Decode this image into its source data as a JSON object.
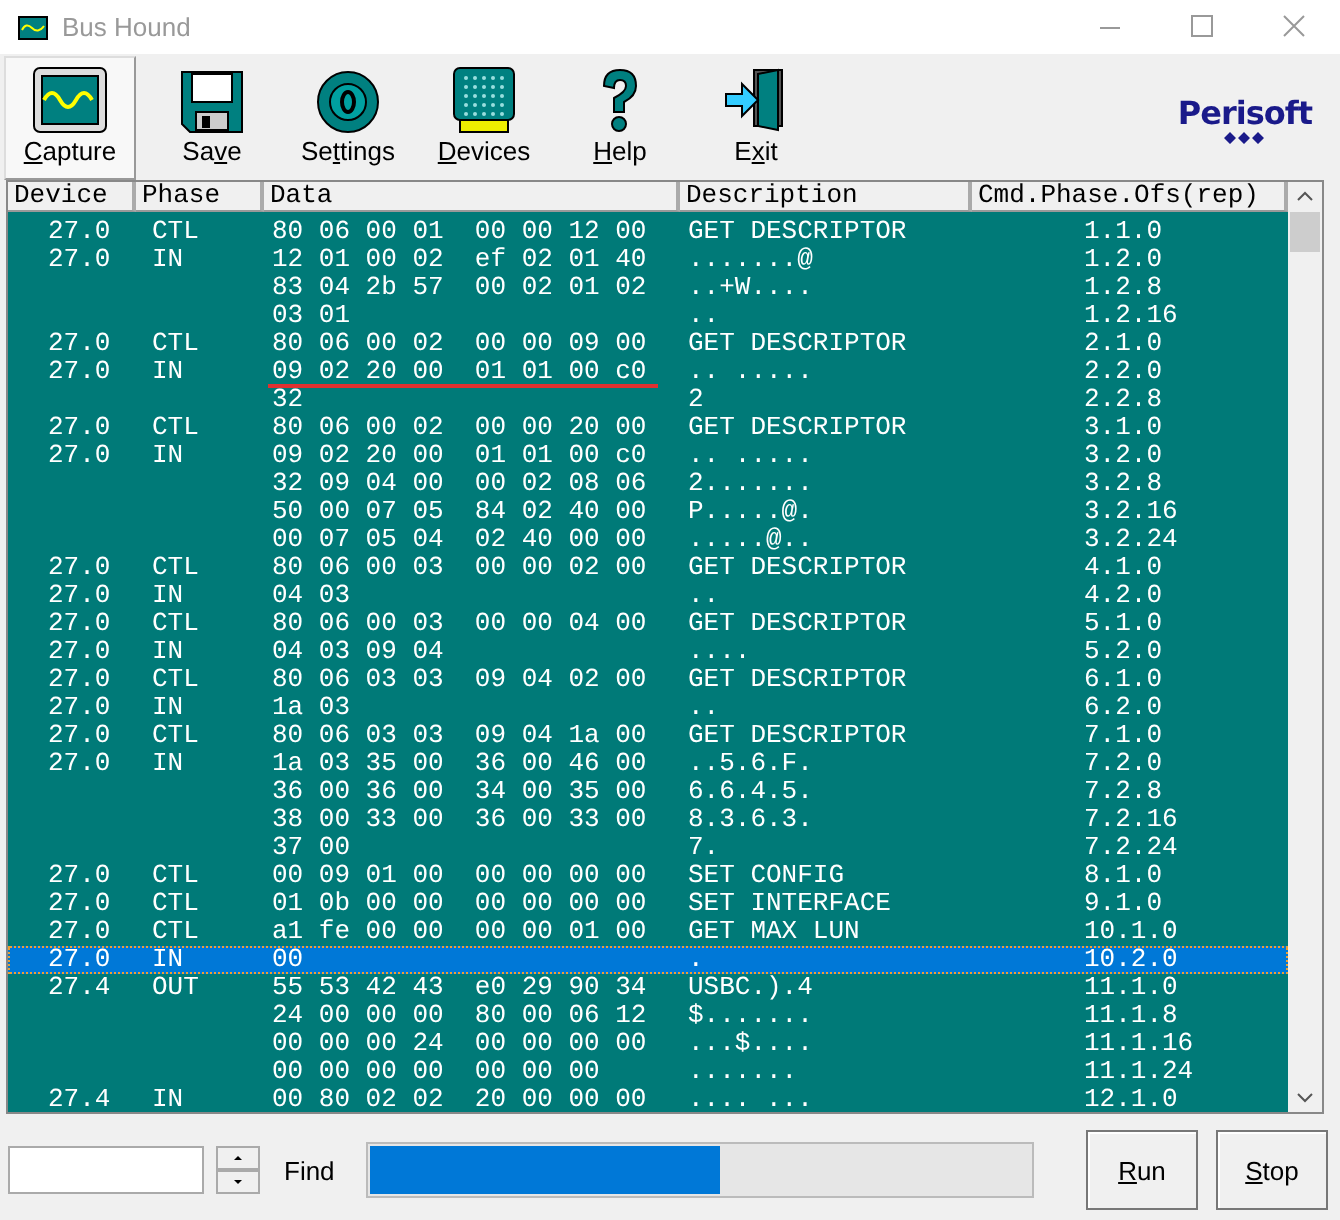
{
  "window": {
    "title": "Bus Hound"
  },
  "toolbar": [
    {
      "key": "C",
      "post": "apture",
      "selected": true
    },
    {
      "pre": "Sa",
      "key": "v",
      "post": "e",
      "selected": false
    },
    {
      "pre": "Se",
      "key": "t",
      "post": "tings",
      "selected": false
    },
    {
      "key": "D",
      "post": "evices",
      "selected": false
    },
    {
      "key": "H",
      "post": "elp",
      "selected": false
    },
    {
      "pre": "E",
      "key": "x",
      "post": "it",
      "selected": false
    }
  ],
  "logo": {
    "text": "Perisoft"
  },
  "table": {
    "columns": [
      "Device",
      "Phase",
      "Data",
      "Description",
      "Cmd.Phase.Ofs(rep)"
    ],
    "rows": [
      {
        "device": "27.0",
        "phase": "CTL",
        "data": "80 06 00 01  00 00 12 00",
        "description": "GET DESCRIPTOR",
        "cmd": "1.1.0",
        "selected": false,
        "underlined": false
      },
      {
        "device": "27.0",
        "phase": "IN",
        "data": "12 01 00 02  ef 02 01 40",
        "description": ".......@",
        "cmd": "1.2.0",
        "selected": false,
        "underlined": false
      },
      {
        "device": "",
        "phase": "",
        "data": "83 04 2b 57  00 02 01 02",
        "description": "..+W....",
        "cmd": "1.2.8",
        "selected": false,
        "underlined": false
      },
      {
        "device": "",
        "phase": "",
        "data": "03 01",
        "description": "..",
        "cmd": "1.2.16",
        "selected": false,
        "underlined": false
      },
      {
        "device": "27.0",
        "phase": "CTL",
        "data": "80 06 00 02  00 00 09 00",
        "description": "GET DESCRIPTOR",
        "cmd": "2.1.0",
        "selected": false,
        "underlined": false
      },
      {
        "device": "27.0",
        "phase": "IN",
        "data": "09 02 20 00  01 01 00 c0",
        "description": ".. .....",
        "cmd": "2.2.0",
        "selected": false,
        "underlined": true
      },
      {
        "device": "",
        "phase": "",
        "data": "32",
        "description": "2",
        "cmd": "2.2.8",
        "selected": false,
        "underlined": false
      },
      {
        "device": "27.0",
        "phase": "CTL",
        "data": "80 06 00 02  00 00 20 00",
        "description": "GET DESCRIPTOR",
        "cmd": "3.1.0",
        "selected": false,
        "underlined": false
      },
      {
        "device": "27.0",
        "phase": "IN",
        "data": "09 02 20 00  01 01 00 c0",
        "description": ".. .....",
        "cmd": "3.2.0",
        "selected": false,
        "underlined": false
      },
      {
        "device": "",
        "phase": "",
        "data": "32 09 04 00  00 02 08 06",
        "description": "2.......",
        "cmd": "3.2.8",
        "selected": false,
        "underlined": false
      },
      {
        "device": "",
        "phase": "",
        "data": "50 00 07 05  84 02 40 00",
        "description": "P.....@.",
        "cmd": "3.2.16",
        "selected": false,
        "underlined": false
      },
      {
        "device": "",
        "phase": "",
        "data": "00 07 05 04  02 40 00 00",
        "description": ".....@..",
        "cmd": "3.2.24",
        "selected": false,
        "underlined": false
      },
      {
        "device": "27.0",
        "phase": "CTL",
        "data": "80 06 00 03  00 00 02 00",
        "description": "GET DESCRIPTOR",
        "cmd": "4.1.0",
        "selected": false,
        "underlined": false
      },
      {
        "device": "27.0",
        "phase": "IN",
        "data": "04 03",
        "description": "..",
        "cmd": "4.2.0",
        "selected": false,
        "underlined": false
      },
      {
        "device": "27.0",
        "phase": "CTL",
        "data": "80 06 00 03  00 00 04 00",
        "description": "GET DESCRIPTOR",
        "cmd": "5.1.0",
        "selected": false,
        "underlined": false
      },
      {
        "device": "27.0",
        "phase": "IN",
        "data": "04 03 09 04",
        "description": "....",
        "cmd": "5.2.0",
        "selected": false,
        "underlined": false
      },
      {
        "device": "27.0",
        "phase": "CTL",
        "data": "80 06 03 03  09 04 02 00",
        "description": "GET DESCRIPTOR",
        "cmd": "6.1.0",
        "selected": false,
        "underlined": false
      },
      {
        "device": "27.0",
        "phase": "IN",
        "data": "1a 03",
        "description": "..",
        "cmd": "6.2.0",
        "selected": false,
        "underlined": false
      },
      {
        "device": "27.0",
        "phase": "CTL",
        "data": "80 06 03 03  09 04 1a 00",
        "description": "GET DESCRIPTOR",
        "cmd": "7.1.0",
        "selected": false,
        "underlined": false
      },
      {
        "device": "27.0",
        "phase": "IN",
        "data": "1a 03 35 00  36 00 46 00",
        "description": "..5.6.F.",
        "cmd": "7.2.0",
        "selected": false,
        "underlined": false
      },
      {
        "device": "",
        "phase": "",
        "data": "36 00 36 00  34 00 35 00",
        "description": "6.6.4.5.",
        "cmd": "7.2.8",
        "selected": false,
        "underlined": false
      },
      {
        "device": "",
        "phase": "",
        "data": "38 00 33 00  36 00 33 00",
        "description": "8.3.6.3.",
        "cmd": "7.2.16",
        "selected": false,
        "underlined": false
      },
      {
        "device": "",
        "phase": "",
        "data": "37 00",
        "description": "7.",
        "cmd": "7.2.24",
        "selected": false,
        "underlined": false
      },
      {
        "device": "27.0",
        "phase": "CTL",
        "data": "00 09 01 00  00 00 00 00",
        "description": "SET CONFIG",
        "cmd": "8.1.0",
        "selected": false,
        "underlined": false
      },
      {
        "device": "27.0",
        "phase": "CTL",
        "data": "01 0b 00 00  00 00 00 00",
        "description": "SET INTERFACE",
        "cmd": "9.1.0",
        "selected": false,
        "underlined": false
      },
      {
        "device": "27.0",
        "phase": "CTL",
        "data": "a1 fe 00 00  00 00 01 00",
        "description": "GET MAX LUN",
        "cmd": "10.1.0",
        "selected": false,
        "underlined": false
      },
      {
        "device": "27.0",
        "phase": "IN",
        "data": "00",
        "description": ".",
        "cmd": "10.2.0",
        "selected": true,
        "underlined": false
      },
      {
        "device": "27.4",
        "phase": "OUT",
        "data": "55 53 42 43  e0 29 90 34",
        "description": "USBC.).4",
        "cmd": "11.1.0",
        "selected": false,
        "underlined": false
      },
      {
        "device": "",
        "phase": "",
        "data": "24 00 00 00  80 00 06 12",
        "description": "$.......",
        "cmd": "11.1.8",
        "selected": false,
        "underlined": false
      },
      {
        "device": "",
        "phase": "",
        "data": "00 00 00 24  00 00 00 00",
        "description": "...$....",
        "cmd": "11.1.16",
        "selected": false,
        "underlined": false
      },
      {
        "device": "",
        "phase": "",
        "data": "00 00 00 00  00 00 00",
        "description": ".......",
        "cmd": "11.1.24",
        "selected": false,
        "underlined": false
      },
      {
        "device": "27.4",
        "phase": "IN",
        "data": "00 80 02 02  20 00 00 00",
        "description": ".... ...",
        "cmd": "12.1.0",
        "selected": false,
        "underlined": false
      }
    ]
  },
  "find": {
    "label": "Find"
  },
  "progress": {
    "level": 0.53
  },
  "buttons": [
    {
      "key": "R",
      "post": "un"
    },
    {
      "key": "S",
      "post": "top"
    }
  ]
}
